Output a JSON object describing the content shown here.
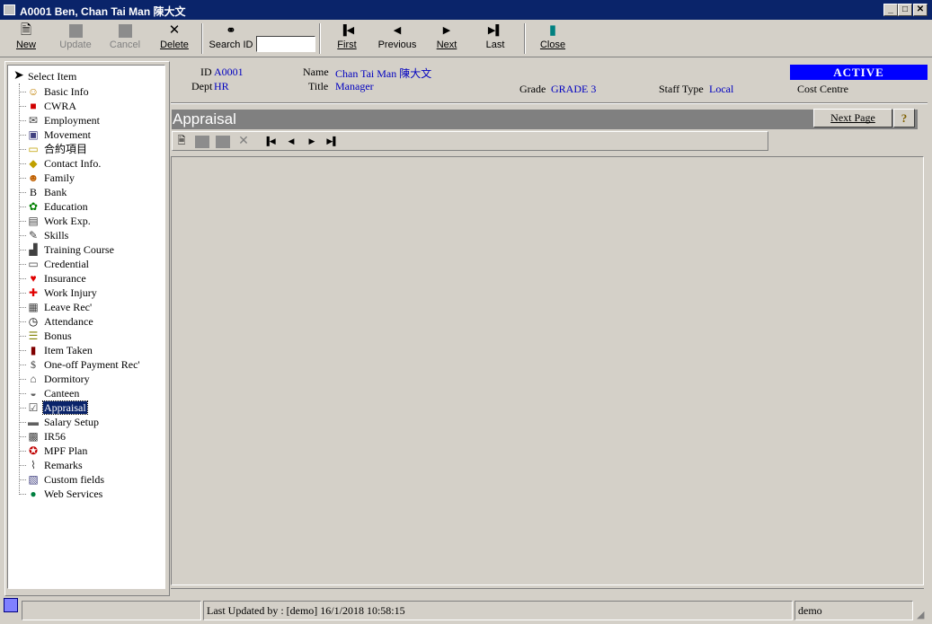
{
  "window": {
    "title": "A0001 Ben, Chan Tai Man 陳大文"
  },
  "toolbar": {
    "new": "New",
    "update": "Update",
    "cancel": "Cancel",
    "delete": "Delete",
    "search_id": "Search ID",
    "search_value": "",
    "first": "First",
    "previous": "Previous",
    "next": "Next",
    "last": "Last",
    "close": "Close"
  },
  "tree": {
    "root": "Select Item",
    "items": [
      {
        "label": "Basic Info",
        "icon": "person-icon",
        "glyph": "☺",
        "color": "#c08000"
      },
      {
        "label": "CWRA",
        "icon": "book-icon",
        "glyph": "■",
        "color": "#d00000"
      },
      {
        "label": "Employment",
        "icon": "envelope-icon",
        "glyph": "✉",
        "color": "#404040"
      },
      {
        "label": "Movement",
        "icon": "computer-icon",
        "glyph": "▣",
        "color": "#404080"
      },
      {
        "label": "合約項目",
        "icon": "folder-icon",
        "glyph": "▭",
        "color": "#c0a000"
      },
      {
        "label": "Contact Info.",
        "icon": "contact-icon",
        "glyph": "◆",
        "color": "#c0a000"
      },
      {
        "label": "Family",
        "icon": "family-icon",
        "glyph": "☻",
        "color": "#c06000"
      },
      {
        "label": "Bank",
        "icon": "bank-icon",
        "glyph": "B",
        "color": "#000000"
      },
      {
        "label": "Education",
        "icon": "education-icon",
        "glyph": "✿",
        "color": "#008000"
      },
      {
        "label": "Work Exp.",
        "icon": "document-icon",
        "glyph": "▤",
        "color": "#404040"
      },
      {
        "label": "Skills",
        "icon": "wrench-icon",
        "glyph": "✎",
        "color": "#404040"
      },
      {
        "label": "Training Course",
        "icon": "training-icon",
        "glyph": "▟",
        "color": "#404040"
      },
      {
        "label": "Credential",
        "icon": "id-card-icon",
        "glyph": "▭",
        "color": "#404040"
      },
      {
        "label": "Insurance",
        "icon": "heart-icon",
        "glyph": "♥",
        "color": "#e00000"
      },
      {
        "label": "Work Injury",
        "icon": "first-aid-icon",
        "glyph": "✚",
        "color": "#e00000"
      },
      {
        "label": "Leave Rec'",
        "icon": "calendar-icon",
        "glyph": "▦",
        "color": "#404040"
      },
      {
        "label": "Attendance",
        "icon": "clock-icon",
        "glyph": "◷",
        "color": "#000000"
      },
      {
        "label": "Bonus",
        "icon": "money-icon",
        "glyph": "☰",
        "color": "#808000"
      },
      {
        "label": "Item Taken",
        "icon": "item-icon",
        "glyph": "▮",
        "color": "#800000"
      },
      {
        "label": "One-off Payment Rec'",
        "icon": "dollar-icon",
        "glyph": "$",
        "color": "#404040"
      },
      {
        "label": "Dormitory",
        "icon": "house-icon",
        "glyph": "⌂",
        "color": "#404040"
      },
      {
        "label": "Canteen",
        "icon": "bowl-icon",
        "glyph": "◒",
        "color": "#606060"
      },
      {
        "label": "Appraisal",
        "icon": "checkbox-icon",
        "glyph": "☑",
        "color": "#404040"
      },
      {
        "label": "Salary Setup",
        "icon": "salary-icon",
        "glyph": "▬",
        "color": "#606060"
      },
      {
        "label": "IR56",
        "icon": "save-disk-icon",
        "glyph": "▩",
        "color": "#404040"
      },
      {
        "label": "MPF Plan",
        "icon": "mpf-icon",
        "glyph": "✪",
        "color": "#c00000"
      },
      {
        "label": "Remarks",
        "icon": "paperclip-icon",
        "glyph": "⌇",
        "color": "#404040"
      },
      {
        "label": "Custom fields",
        "icon": "custom-icon",
        "glyph": "▧",
        "color": "#404080"
      },
      {
        "label": "Web Services",
        "icon": "globe-icon",
        "glyph": "●",
        "color": "#008040"
      }
    ],
    "selected": "Appraisal"
  },
  "header": {
    "id_label": "ID",
    "id_value": "A0001",
    "dept_label": "Dept",
    "dept_value": "HR",
    "name_label": "Name",
    "name_value": "Chan Tai Man  陳大文",
    "title_label": "Title",
    "title_value": "Manager",
    "grade_label": "Grade",
    "grade_value": "GRADE 3",
    "staff_type_label": "Staff Type",
    "staff_type_value": "Local",
    "status": "ACTIVE",
    "cost_centre_label": "Cost Centre"
  },
  "panel": {
    "title": "Appraisal",
    "next_page": "Next Page",
    "help": "?"
  },
  "status_bar": {
    "last_updated": "Last Updated by : [demo]  16/1/2018 10:58:15",
    "user": "demo"
  }
}
